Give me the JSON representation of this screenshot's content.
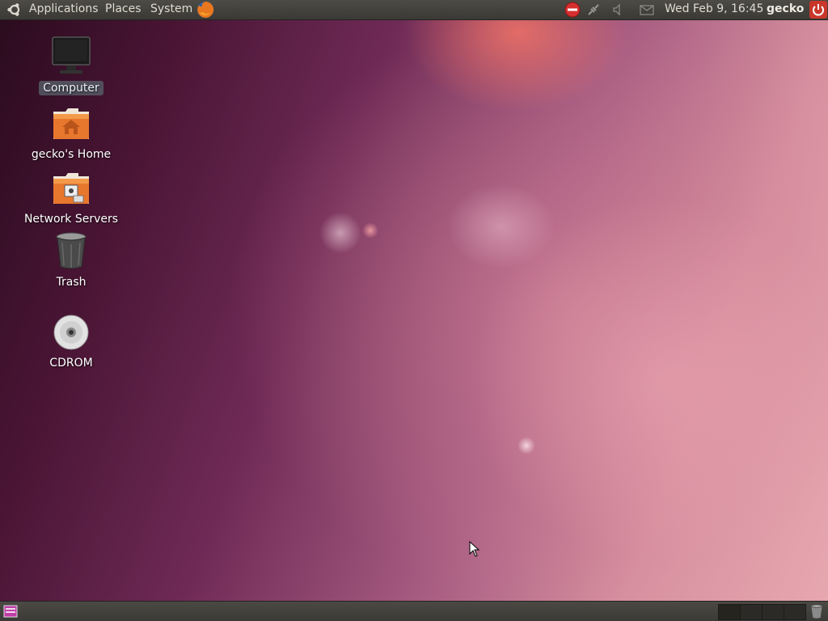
{
  "top_panel": {
    "menus": [
      {
        "label": "Applications"
      },
      {
        "label": "Places"
      },
      {
        "label": "System"
      }
    ],
    "launcher_icons": [
      "ubuntu-logo-icon",
      "firefox-icon"
    ],
    "tray_icons": [
      "network-disconnected-icon",
      "network-wired-icon",
      "volume-icon",
      "mail-icon"
    ],
    "clock": "Wed Feb  9, 16:45",
    "username": "gecko",
    "session_icon": "power-icon"
  },
  "desktop": {
    "icons": [
      {
        "label": "Computer",
        "icon": "computer-icon",
        "selected": true
      },
      {
        "label": "gecko's Home",
        "icon": "home-folder-icon",
        "selected": false
      },
      {
        "label": "Network Servers",
        "icon": "network-servers-icon",
        "selected": false
      },
      {
        "label": "Trash",
        "icon": "trash-icon",
        "selected": false
      },
      {
        "label": "CDROM",
        "icon": "cdrom-icon",
        "selected": false
      }
    ]
  },
  "bottom_panel": {
    "show_desktop_icon": "show-desktop-icon",
    "workspaces": [
      "workspace-1",
      "workspace-2",
      "workspace-3",
      "workspace-4"
    ],
    "trash_icon": "trash-applet-icon"
  },
  "colors": {
    "panel": "#3f3e3a",
    "panel_text": "#dfdbd2",
    "power_red": "#d6402f",
    "folder_orange": "#e8772e"
  }
}
